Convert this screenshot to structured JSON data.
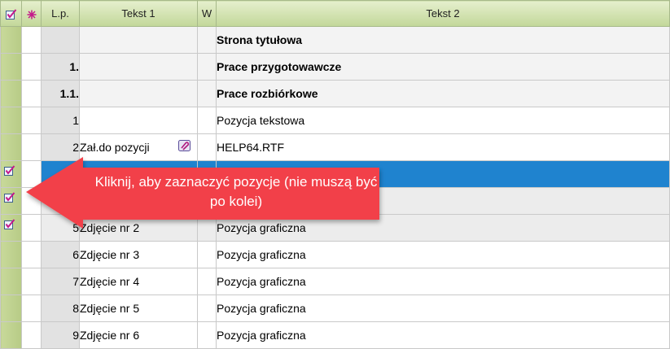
{
  "headers": {
    "select": "select-all",
    "mark": "mark",
    "lp": "L.p.",
    "tekst1": "Tekst 1",
    "w": "W",
    "tekst2": "Tekst 2"
  },
  "rows": [
    {
      "lp": "",
      "tekst1": "",
      "tekst2": "Strona tytułowa",
      "kind": "chapter",
      "checked": false
    },
    {
      "lp": "1.",
      "tekst1": "",
      "tekst2": "Prace przygotowawcze",
      "kind": "chapter",
      "checked": false
    },
    {
      "lp": "1.1.",
      "tekst1": "",
      "tekst2": "Prace rozbiórkowe",
      "kind": "chapter",
      "checked": false
    },
    {
      "lp": "1",
      "tekst1": "",
      "tekst2": "Pozycja tekstowa",
      "kind": "item",
      "checked": false
    },
    {
      "lp": "2",
      "tekst1": "Zał.do pozycji",
      "tekst2": "HELP64.RTF",
      "kind": "item",
      "checked": false,
      "attachment": true
    },
    {
      "lp": "",
      "tekst1": "",
      "tekst2": "",
      "kind": "selected-blue",
      "checked": true
    },
    {
      "lp": "",
      "tekst1": "",
      "tekst2": "",
      "kind": "selected",
      "checked": true
    },
    {
      "lp": "5",
      "tekst1": "Zdjęcie nr 2",
      "tekst2": "Pozycja graficzna",
      "kind": "selected",
      "checked": true
    },
    {
      "lp": "6",
      "tekst1": "Zdjęcie nr 3",
      "tekst2": "Pozycja graficzna",
      "kind": "item",
      "checked": false
    },
    {
      "lp": "7",
      "tekst1": "Zdjęcie nr 4",
      "tekst2": "Pozycja graficzna",
      "kind": "item",
      "checked": false
    },
    {
      "lp": "8",
      "tekst1": "Zdjęcie nr 5",
      "tekst2": "Pozycja graficzna",
      "kind": "item",
      "checked": false
    },
    {
      "lp": "9",
      "tekst1": "Zdjęcie nr 6",
      "tekst2": "Pozycja graficzna",
      "kind": "item",
      "checked": false
    }
  ],
  "callout": {
    "text": "Kliknij, aby zaznaczyć pozycje (nie muszą być po kolei)"
  },
  "colors": {
    "callout": "#f2414a",
    "selection": "#1f83cf",
    "header": "#c2d799"
  }
}
